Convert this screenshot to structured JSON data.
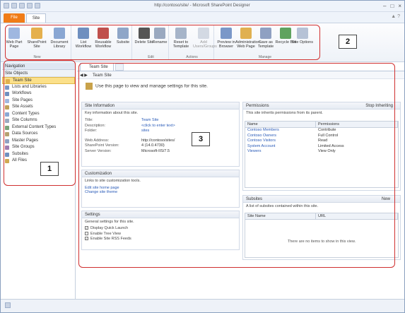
{
  "window": {
    "title": "http://contoso/site/ - Microsoft SharePoint Designer"
  },
  "tabs": {
    "file": "File",
    "site": "Site"
  },
  "ribbon": {
    "groups": [
      {
        "label": "New",
        "buttons": [
          "Web Part Page",
          "SharePoint Site",
          "Document Library"
        ]
      },
      {
        "label": "",
        "buttons": [
          "List Workflow",
          "Reusable Workflow",
          "Subsite"
        ]
      },
      {
        "label": "Edit",
        "buttons": [
          "Delete Site",
          "Rename"
        ]
      },
      {
        "label": "Actions",
        "buttons": [
          "Reset to Template",
          "Add Users/Groups"
        ]
      },
      {
        "label": "Manage",
        "buttons": [
          "Preview in Browser",
          "Administration Web Page",
          "Save as Template",
          "Recycle Bin",
          "Site Options"
        ]
      }
    ]
  },
  "navigation": {
    "header": "Navigation",
    "sub": "Site Objects",
    "items": [
      "Team Site",
      "Lists and Libraries",
      "Workflows",
      "Site Pages",
      "Site Assets",
      "Content Types",
      "Site Columns",
      "External Content Types",
      "Data Sources",
      "Master Pages",
      "Site Groups",
      "Subsites",
      "All Files"
    ]
  },
  "doc": {
    "tab": "Team Site",
    "breadcrumb": "Team Site",
    "hint": "Use this page to view and manage settings for this site."
  },
  "site_info": {
    "title": "Site Information",
    "subtitle": "Key information about this site.",
    "rows": [
      {
        "label": "Title:",
        "value": "Team Site"
      },
      {
        "label": "Description:",
        "value": "<click to enter text>"
      },
      {
        "label": "Folder:",
        "value": "sites"
      },
      {
        "label": "Web Address:",
        "value": "http://contoso/sites/"
      },
      {
        "label": "SharePoint Version:",
        "value": "4 (14.0.4730)"
      },
      {
        "label": "Server Version:",
        "value": "Microsoft-IIS/7.5"
      }
    ]
  },
  "customization": {
    "title": "Customization",
    "subtitle": "Links to site customization tools.",
    "links": [
      "Edit site home page",
      "Change site theme"
    ]
  },
  "settings": {
    "title": "Settings",
    "subtitle": "General settings for this site.",
    "options": [
      {
        "label": "Display Quick Launch",
        "checked": true
      },
      {
        "label": "Enable Tree View",
        "checked": false
      },
      {
        "label": "Enable Site RSS Feeds",
        "checked": true
      }
    ]
  },
  "permissions": {
    "title": "Permissions",
    "stop": "Stop Inheriting",
    "note": "This site inherits permissions from its parent.",
    "headers": [
      "Name",
      "Permissions"
    ],
    "rows": [
      {
        "name": "Contoso Members",
        "perm": "Contribute"
      },
      {
        "name": "Contoso Owners",
        "perm": "Full Control"
      },
      {
        "name": "Contoso Visitors",
        "perm": "Read"
      },
      {
        "name": "System Account",
        "perm": "Limited Access"
      },
      {
        "name": "Viewers",
        "perm": "View Only"
      }
    ]
  },
  "subsites": {
    "title": "Subsites",
    "new": "New",
    "note": "A list of subsites contained within this site.",
    "headers": [
      "Site Name",
      "URL"
    ],
    "empty": "There are no items to show in this view."
  },
  "callouts": [
    "1",
    "2",
    "3"
  ],
  "colors": {
    "accent": "#f07c17",
    "callout": "#d03030"
  }
}
